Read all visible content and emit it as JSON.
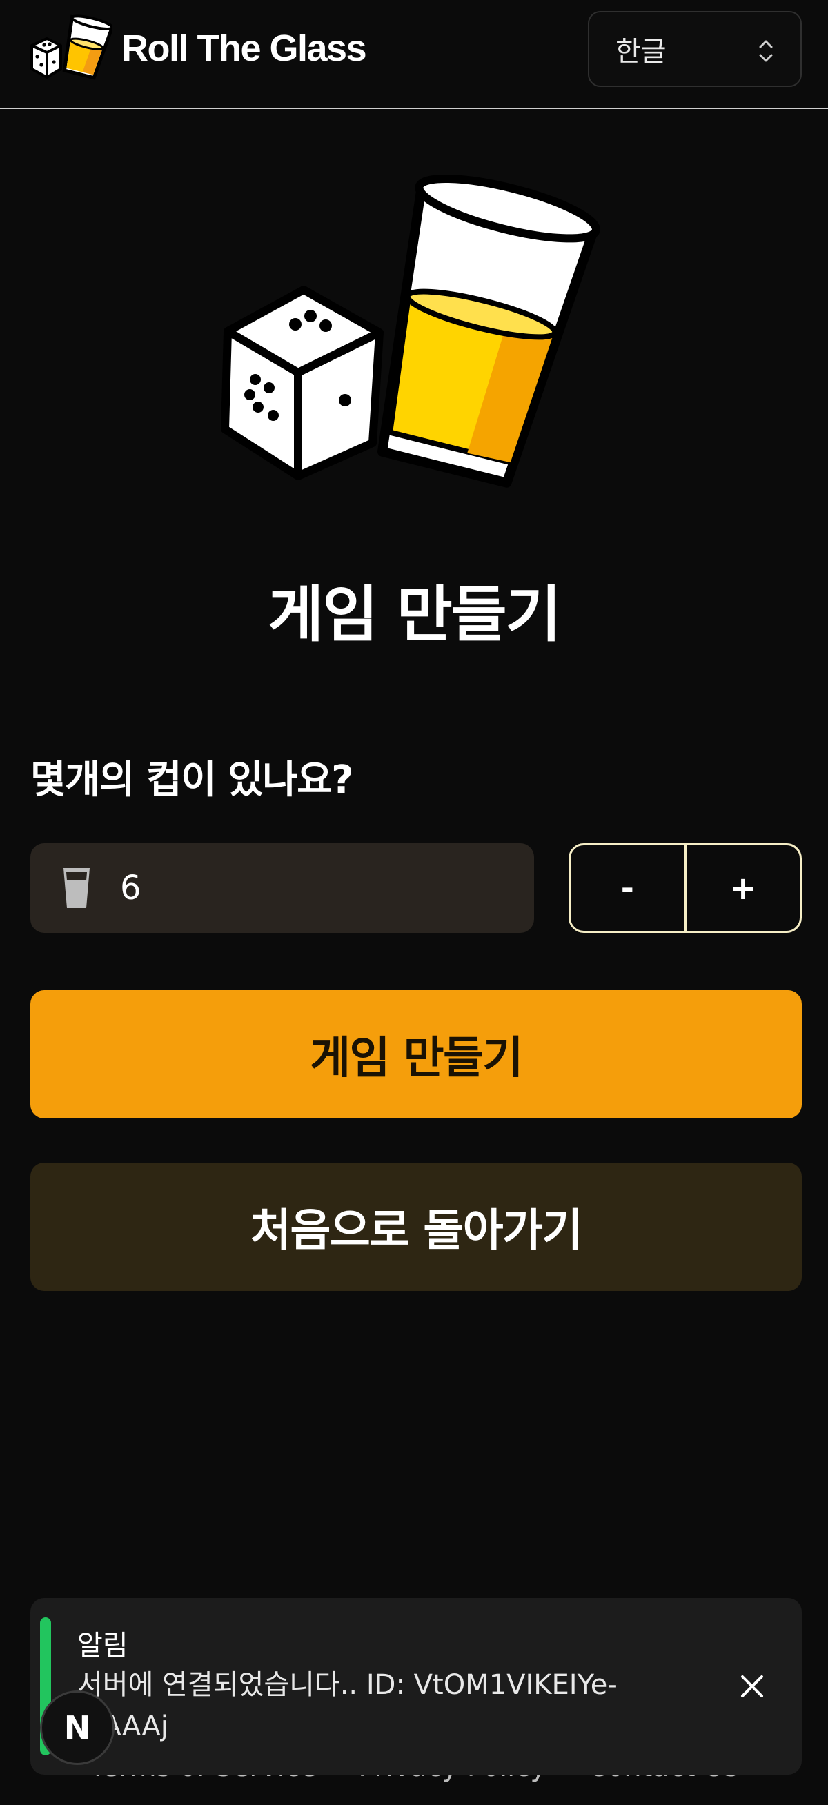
{
  "header": {
    "app_name": "Roll The Glass",
    "language": {
      "selected": "한글"
    }
  },
  "main": {
    "title": "게임 만들기",
    "question": "몇개의 컵이 있나요?",
    "cup_count": "6",
    "decrement_label": "-",
    "increment_label": "+",
    "create_button": "게임 만들기",
    "home_button": "처음으로 돌아가기"
  },
  "footer": {
    "links": [
      "Terms of Service",
      "Privacy Policy",
      "Contact Us"
    ]
  },
  "toast": {
    "title": "알림",
    "message": "서버에 연결되었습니다.. ID: VtOM1VIKEIYe-nJAAAj"
  },
  "dev_badge": {
    "label": "N"
  },
  "colors": {
    "background": "#0b0b0b",
    "accent": "#f59e0b",
    "secondary_button": "#2e2613",
    "input_bg": "#29241f",
    "success": "#22c55e",
    "stepper_border": "#f6eec6"
  },
  "icons": {
    "logo": "dice-and-glass-logo",
    "hero": "dice-and-glass-illustration",
    "input": "beer-glass-icon",
    "select": "chevron-up-down-icon",
    "close": "close-icon"
  }
}
